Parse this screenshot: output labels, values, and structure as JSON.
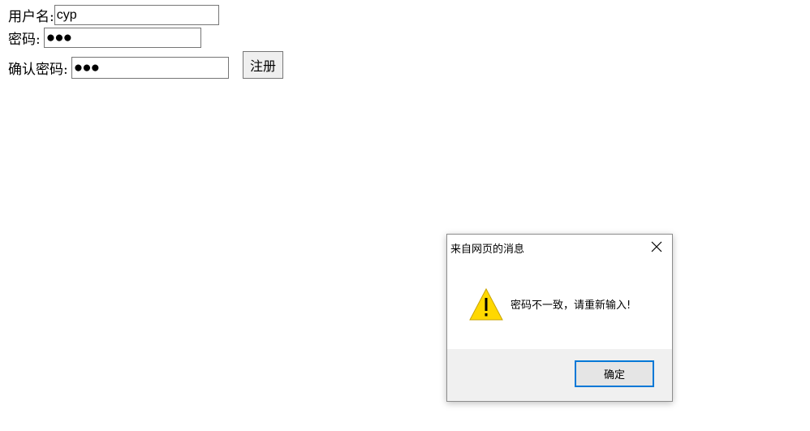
{
  "form": {
    "username_label": "用户名:",
    "username_value": "cyp",
    "password_label": "密码:",
    "password_value": "●●●",
    "confirm_label": "确认密码:",
    "confirm_value": "●●●",
    "submit_label": "注册"
  },
  "dialog": {
    "title": "来自网页的消息",
    "message": "密码不一致，请重新输入!",
    "ok_label": "确定",
    "icon": "warning-icon"
  }
}
